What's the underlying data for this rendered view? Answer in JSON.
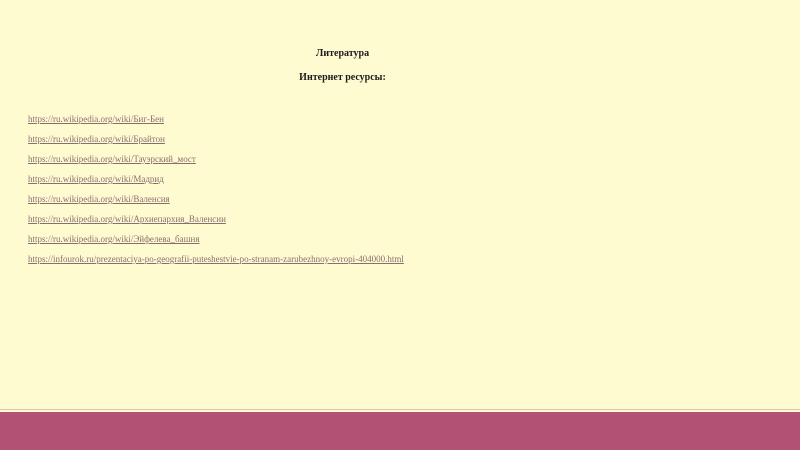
{
  "slide": {
    "title": "Литература",
    "subtitle": "Интернет ресурсы:",
    "links": [
      "https://ru.wikipedia.org/wiki/Биг-Бен",
      "https://ru.wikipedia.org/wiki/Брайтон",
      "https://ru.wikipedia.org/wiki/Тауэрский_мост",
      "https://ru.wikipedia.org/wiki/Мадрид",
      "https://ru.wikipedia.org/wiki/Валенсия",
      "https://ru.wikipedia.org/wiki/Архиепархия_Валенсии",
      "https://ru.wikipedia.org/wiki/Эйфелева_башня",
      "https://infourok.ru/prezentaciya-po-geografii-puteshestvie-po-stranam-zarubezhnoy-evropi-404000.html"
    ]
  },
  "colors": {
    "background": "#fefbd0",
    "link": "#8a6e6e",
    "footer_bar": "#b25173",
    "footer_line": "#d7c6b4",
    "heading": "#1c1c1c"
  }
}
